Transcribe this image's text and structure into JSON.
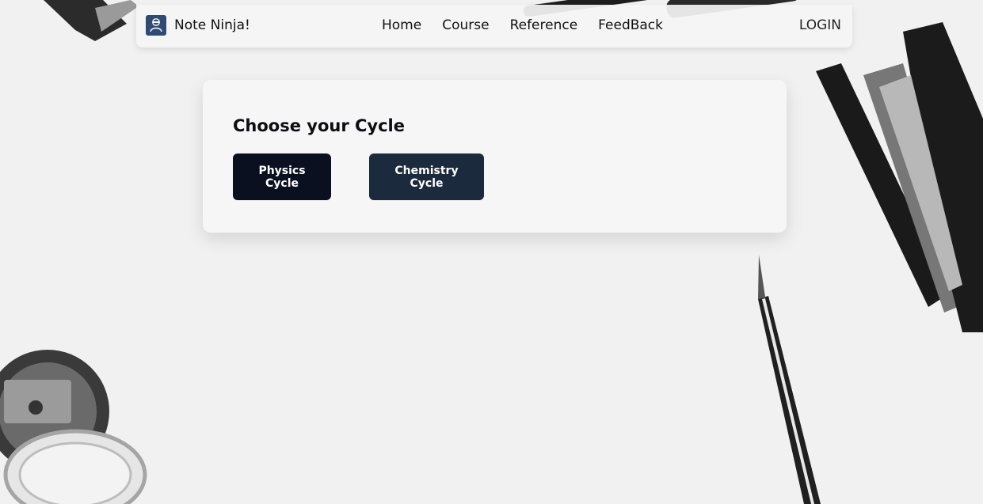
{
  "colors": {
    "page_background": "#f1f1f1",
    "physics_button_bg": "#0b1020",
    "chemistry_button_bg": "#1c2a3d",
    "logo_bg": "#2f4b74"
  },
  "navbar": {
    "brand_name": "Note Ninja!",
    "brand_icon": "ninja-logo-icon",
    "links": [
      "Home",
      "Course",
      "Reference",
      "FeedBack"
    ],
    "login_label": "LOGIN"
  },
  "card": {
    "title": "Choose your Cycle",
    "physics_label": "Physics Cycle",
    "chemistry_label": "Chemistry Cycle"
  }
}
